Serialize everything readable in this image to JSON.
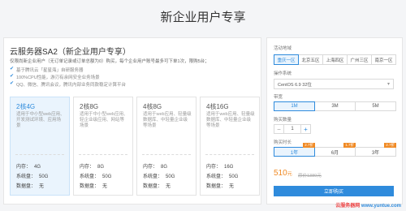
{
  "header": {
    "title": "新企业用户专享"
  },
  "product": {
    "title": "云服务器SA2（新企业用户专享）",
    "description": "仅限尚新企业用户（无订单记录或订单总额为0）购买，每个企业用户账号最多可下单1次，限购5台；",
    "features": [
      "基于腾讯云「星星海」自研服务器",
      "100%CPU性能，游刃有余网安全业务场景",
      "QQ、微信、腾讯会议，腾讯内部业务同款稳定计算平台"
    ]
  },
  "cards": [
    {
      "name": "2核4G",
      "desc": "适用于中小型web应用、开发测试环境、应用场景",
      "mem_label": "内存：",
      "mem": "4G",
      "sys_label": "系统盘：",
      "sys": "50G",
      "data_label": "数据盘：",
      "data": "无"
    },
    {
      "name": "2核8G",
      "desc": "适用于中小型web应用、轻企业级应用、网站等场景",
      "mem_label": "内存：",
      "mem": "8G",
      "sys_label": "系统盘：",
      "sys": "50G",
      "data_label": "数据盘：",
      "data": "无"
    },
    {
      "name": "4核8G",
      "desc": "适用于web应用、轻量级数据库、中轻量企业级等场景",
      "mem_label": "内存：",
      "mem": "8G",
      "sys_label": "系统盘：",
      "sys": "50G",
      "data_label": "数据盘：",
      "data": "无"
    },
    {
      "name": "4核16G",
      "desc": "适用于web应用、轻量级数据库、中轻量企业级等场景",
      "mem_label": "内存：",
      "mem": "16G",
      "sys_label": "系统盘：",
      "sys": "50G",
      "data_label": "数据盘：",
      "data": "无"
    }
  ],
  "config": {
    "region_label": "活动地域",
    "regions": [
      "重庆一区",
      "北京五区",
      "上海四区",
      "广州三区",
      "南京一区"
    ],
    "os_label": "操作系统",
    "os_value": "CentOS 6.9 32位",
    "bw_label": "带宽",
    "bandwidths": [
      "1M",
      "3M",
      "5M"
    ],
    "qty_label": "购买数量",
    "qty_value": "1",
    "qty_minus": "−",
    "qty_plus": "+",
    "dur_label": "购买时长",
    "durations": [
      "1年",
      "6月",
      "3年"
    ],
    "dur_badges": [
      "2.7折",
      "1.7折",
      "2.7折"
    ],
    "price": "510",
    "price_unit": "元",
    "orig_price": "原价1380元",
    "buy_label": "立即购买"
  },
  "watermark": {
    "part1": "云服务器网",
    "part2": "www.yuntue.com"
  },
  "colors": {
    "accent": "#2f8bdc",
    "price": "#f08a24"
  }
}
